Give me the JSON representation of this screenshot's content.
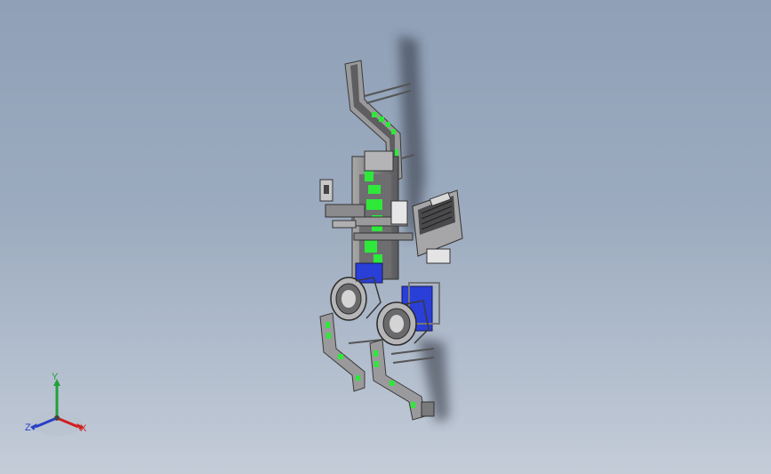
{
  "viewport": {
    "background_top": "#8fa0b7",
    "background_bottom": "#c4ccd8"
  },
  "model": {
    "frame_color": "#8a8a8c",
    "frame_edge": "#3a3a3a",
    "accent_green": "#2ee83a",
    "accent_blue": "#2a3ed8",
    "shadow_color": "#2a2f3a"
  },
  "triad": {
    "x_label": "X",
    "y_label": "Y",
    "z_label": "Z",
    "x_color": "#d02020",
    "y_color": "#22a03a",
    "z_color": "#2840c8"
  }
}
